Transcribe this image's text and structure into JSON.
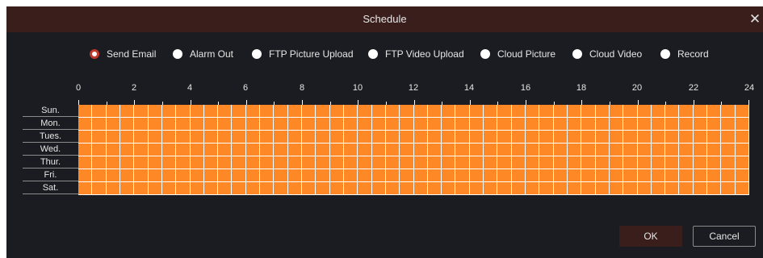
{
  "dialog": {
    "title": "Schedule",
    "close_icon": "close-icon"
  },
  "options": [
    {
      "label": "Send Email",
      "checked": true
    },
    {
      "label": "Alarm Out",
      "checked": false
    },
    {
      "label": "FTP Picture Upload",
      "checked": false
    },
    {
      "label": "FTP Video Upload",
      "checked": false
    },
    {
      "label": "Cloud Picture",
      "checked": false
    },
    {
      "label": "Cloud Video",
      "checked": false
    },
    {
      "label": "Record",
      "checked": false
    }
  ],
  "hours": [
    "0",
    "2",
    "4",
    "6",
    "8",
    "10",
    "12",
    "14",
    "16",
    "18",
    "20",
    "22",
    "24"
  ],
  "days": [
    "Sun.",
    "Mon.",
    "Tues.",
    "Wed.",
    "Thur.",
    "Fri.",
    "Sat."
  ],
  "schedule": {
    "cells_per_day": 48,
    "all_selected": true,
    "selected_color": "#ff8826"
  },
  "buttons": {
    "ok": "OK",
    "cancel": "Cancel"
  },
  "colors": {
    "title_bar": "#3a1e1b",
    "background": "#1b1c21",
    "accent": "#c0392b"
  }
}
